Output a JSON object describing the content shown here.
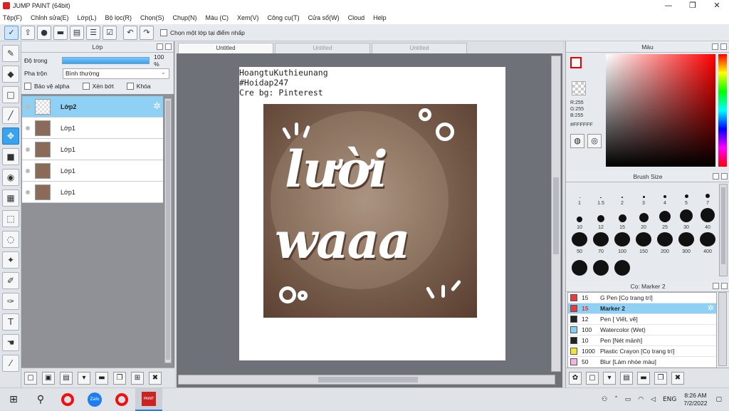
{
  "window": {
    "title": "JUMP PAINT (64bit)"
  },
  "menu": [
    "Tệp(F)",
    "Chỉnh sửa(E)",
    "Lớp(L)",
    "Bộ lọc(R)",
    "Chọn(S)",
    "Chụp(N)",
    "Màu (C)",
    "Xem(V)",
    "Công cụ(T)",
    "Cửa sổ(W)",
    "Cloud",
    "Help"
  ],
  "toolbar": {
    "option_label": "Chọn một lớp tại điểm nhấp"
  },
  "layer_panel": {
    "title": "Lớp",
    "opacity_label": "Độ trong",
    "opacity_value": "100 %",
    "blend_label": "Pha trộn",
    "blend_value": "Bình thường",
    "protect_alpha": "Bảo vệ alpha",
    "clipping": "Xén bớt",
    "lock": "Khóa",
    "layers": [
      "Lớp2",
      "Lớp1",
      "Lớp1",
      "Lớp1",
      "Lớp1"
    ]
  },
  "canvas": {
    "tabs": [
      "Untitled",
      "Untitled",
      "Untitled"
    ],
    "text_lines": [
      "HoangtuKuthieunang",
      "#Hoidap247",
      "Cre bg: Pinterest"
    ],
    "art_line1": "lười",
    "art_line2": "waaa"
  },
  "color_panel": {
    "title": "Màu",
    "r": "R:255",
    "g": "G:255",
    "b": "B:255",
    "hex": "#FFFFFF"
  },
  "brush_panel": {
    "title": "Brush Size",
    "sizes": [
      "1",
      "1.5",
      "2",
      "3",
      "4",
      "5",
      "7",
      "10",
      "12",
      "15",
      "20",
      "25",
      "30",
      "40",
      "50",
      "70",
      "100",
      "150",
      "200",
      "300",
      "400",
      "",
      "",
      ""
    ]
  },
  "subtool_panel": {
    "title": "Cọ: Marker 2",
    "items": [
      {
        "size": "15",
        "name": "G Pen [Cọ trang trí]",
        "color": "#e83b3b"
      },
      {
        "size": "15",
        "name": "Marker 2",
        "color": "#e83b3b"
      },
      {
        "size": "12",
        "name": "Pen [ Viết, vẽ]",
        "color": "#222222"
      },
      {
        "size": "100",
        "name": "Watercolor (Wet)",
        "color": "#7fd3f5"
      },
      {
        "size": "10",
        "name": "Pen [Nét mảnh]",
        "color": "#222222"
      },
      {
        "size": "1000",
        "name": "Plastic Crayon [Cọ trang trí]",
        "color": "#f3e23a"
      },
      {
        "size": "50",
        "name": "Blur [Làm nhòe màu]",
        "color": "#f7b3e0"
      }
    ]
  },
  "taskbar": {
    "lang": "ENG",
    "time": "8:26 AM",
    "date": "7/2/2022"
  }
}
